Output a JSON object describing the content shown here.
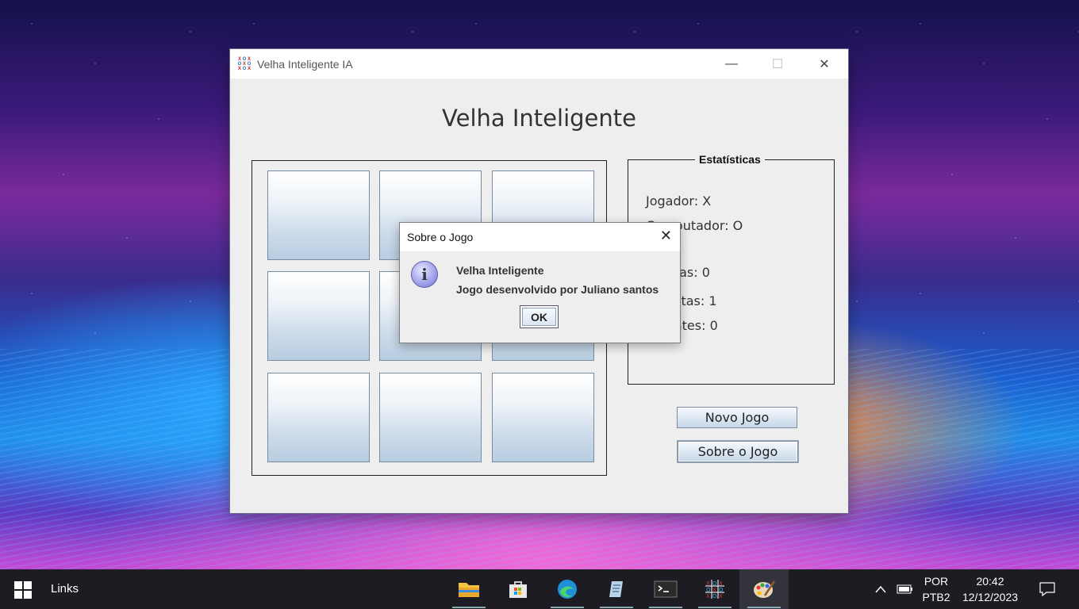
{
  "window": {
    "title": "Velha Inteligente IA",
    "controls": {
      "minimize": "—",
      "maximize": "☐",
      "close": "✕"
    },
    "heading": "Velha Inteligente",
    "board": {
      "cells": [
        "",
        "",
        "",
        "",
        "",
        "",
        "",
        "",
        ""
      ]
    },
    "stats": {
      "legend": "Estatísticas",
      "player": "Jogador: X",
      "computer": "Computador: O",
      "wins": "Vitórias: 0",
      "losses": "Derrotas: 1",
      "draws": "Empates: 0"
    },
    "buttons": {
      "new_game": "Novo Jogo",
      "about": "Sobre o Jogo"
    }
  },
  "dialog": {
    "title": "Sobre o Jogo",
    "close": "✕",
    "icon_char": "i",
    "line1": "Velha Inteligente",
    "line2": "Jogo desenvolvido por Juliano santos",
    "ok_label": "OK"
  },
  "taskbar": {
    "links_label": "Links",
    "apps": [
      "file-explorer-icon",
      "microsoft-store-icon",
      "edge-icon",
      "notepad-icon",
      "terminal-icon",
      "tic-tac-toe-icon",
      "paint-icon"
    ],
    "language_top": "POR",
    "language_bottom": "PTB2",
    "time": "20:42",
    "date": "12/12/2023"
  }
}
